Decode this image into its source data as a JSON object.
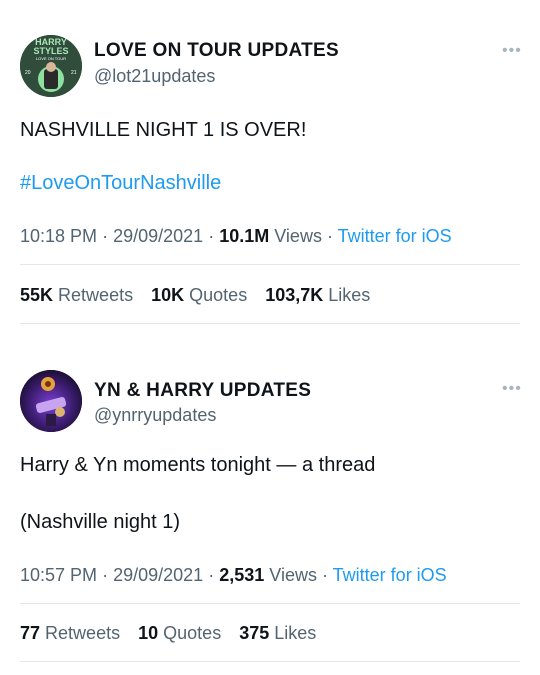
{
  "tweets": [
    {
      "name": "LOVE ON TOUR UPDATES",
      "handle": "@lot21updates",
      "avatar": {
        "line1": "HARRY",
        "line2": "STYLES",
        "line3": "LOVE ON TOUR",
        "left_num": "20",
        "right_num": "21"
      },
      "more": "•••",
      "text_line1": "NASHVILLE NIGHT 1 IS OVER!",
      "hashtag": "#LoveOnTourNashville",
      "time": "10:18 PM",
      "date": "29/09/2021",
      "views_count": "10.1M",
      "views_label": "Views",
      "source": "Twitter for iOS",
      "retweets_count": "55K",
      "retweets_label": "Retweets",
      "quotes_count": "10K",
      "quotes_label": "Quotes",
      "likes_count": "103,7K",
      "likes_label": "Likes"
    },
    {
      "name": "YN & HARRY UPDATES",
      "handle": "@ynrryupdates",
      "more": "•••",
      "text_line1": "Harry & Yn moments tonight — a thread",
      "text_line2": "(Nashville night 1)",
      "time": "10:57 PM",
      "date": "29/09/2021",
      "views_count": "2,531",
      "views_label": "Views",
      "source": "Twitter for iOS",
      "retweets_count": "77",
      "retweets_label": "Retweets",
      "quotes_count": "10",
      "quotes_label": "Quotes",
      "likes_count": "375",
      "likes_label": "Likes"
    }
  ],
  "separator": "·"
}
